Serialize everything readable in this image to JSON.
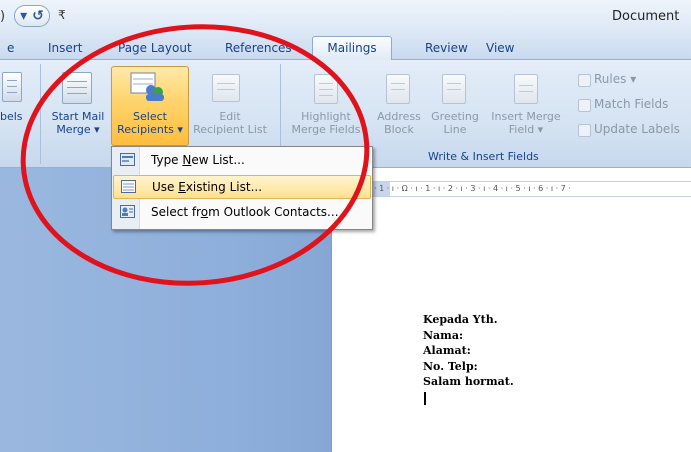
{
  "titlebar": {
    "undo_fragment": ")",
    "redo_glyph": "▾ ↺",
    "customize_glyph": "₹",
    "document_title": "Document"
  },
  "tabs": {
    "home_fragment": "e",
    "insert": "Insert",
    "page_layout": "Page Layout",
    "references": "References",
    "mailings": "Mailings",
    "review": "Review",
    "view": "View"
  },
  "ribbon": {
    "labels_fragment_line1": "",
    "labels_fragment_line2": "bels",
    "start_mail_merge": {
      "line1": "Start Mail",
      "line2": "Merge ▾"
    },
    "select_recipients": {
      "line1": "Select",
      "line2": "Recipients ▾"
    },
    "edit_recipient_list": {
      "line1": "Edit",
      "line2": "Recipient List"
    },
    "highlight_merge_fields": {
      "line1": "Highlight",
      "line2": "Merge Fields"
    },
    "address_block": {
      "line1": "Address",
      "line2": "Block"
    },
    "greeting_line": {
      "line1": "Greeting",
      "line2": "Line"
    },
    "insert_merge_field": {
      "line1": "Insert Merge",
      "line2": "Field ▾"
    },
    "rules": "Rules ▾",
    "match_fields": "Match Fields",
    "update_labels": "Update Labels",
    "group_write_insert": "Write & Insert Fields"
  },
  "menu": {
    "items": [
      {
        "label": "Type New List...",
        "underline": "N"
      },
      {
        "label": "Use Existing List...",
        "underline": "E"
      },
      {
        "label": "Select from Outlook Contacts...",
        "underline": "o"
      }
    ]
  },
  "ruler": {
    "text": "· 1 · ı · Ω · ı · 1 · ı · 2 · ı · 3 · ı · 4 · ı · 5 · ı · 6 · ı · 7 ·"
  },
  "document": {
    "lines": [
      "Kepada Yth.",
      "Nama:",
      "Alamat:",
      "No. Telp:",
      "Salam hormat."
    ]
  },
  "colors": {
    "annotation": "#e0121b",
    "selected_button": "#ffc54d",
    "menu_hover": "#ffe7a0",
    "ribbon_text": "#15428b"
  }
}
